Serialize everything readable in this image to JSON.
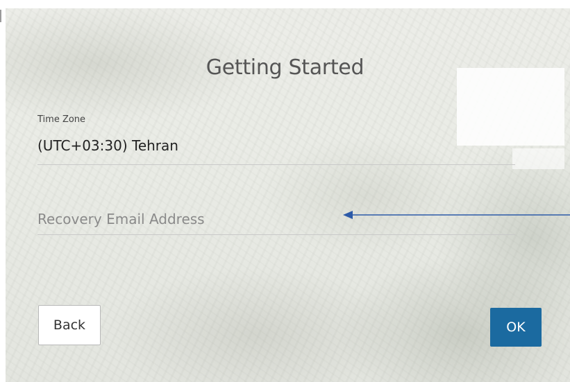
{
  "dialog": {
    "title": "Getting Started"
  },
  "time_zone": {
    "label": "Time Zone",
    "value": "(UTC+03:30) Tehran"
  },
  "recovery_email": {
    "placeholder": "Recovery Email Address",
    "value": ""
  },
  "buttons": {
    "back_label": "Back",
    "ok_label": "OK"
  },
  "colors": {
    "ok_button": "#1b6aa0",
    "annotation_arrow": "#2c5aa8"
  },
  "annotations": {
    "arrow_icon": "left-arrow-annotation-icon"
  }
}
